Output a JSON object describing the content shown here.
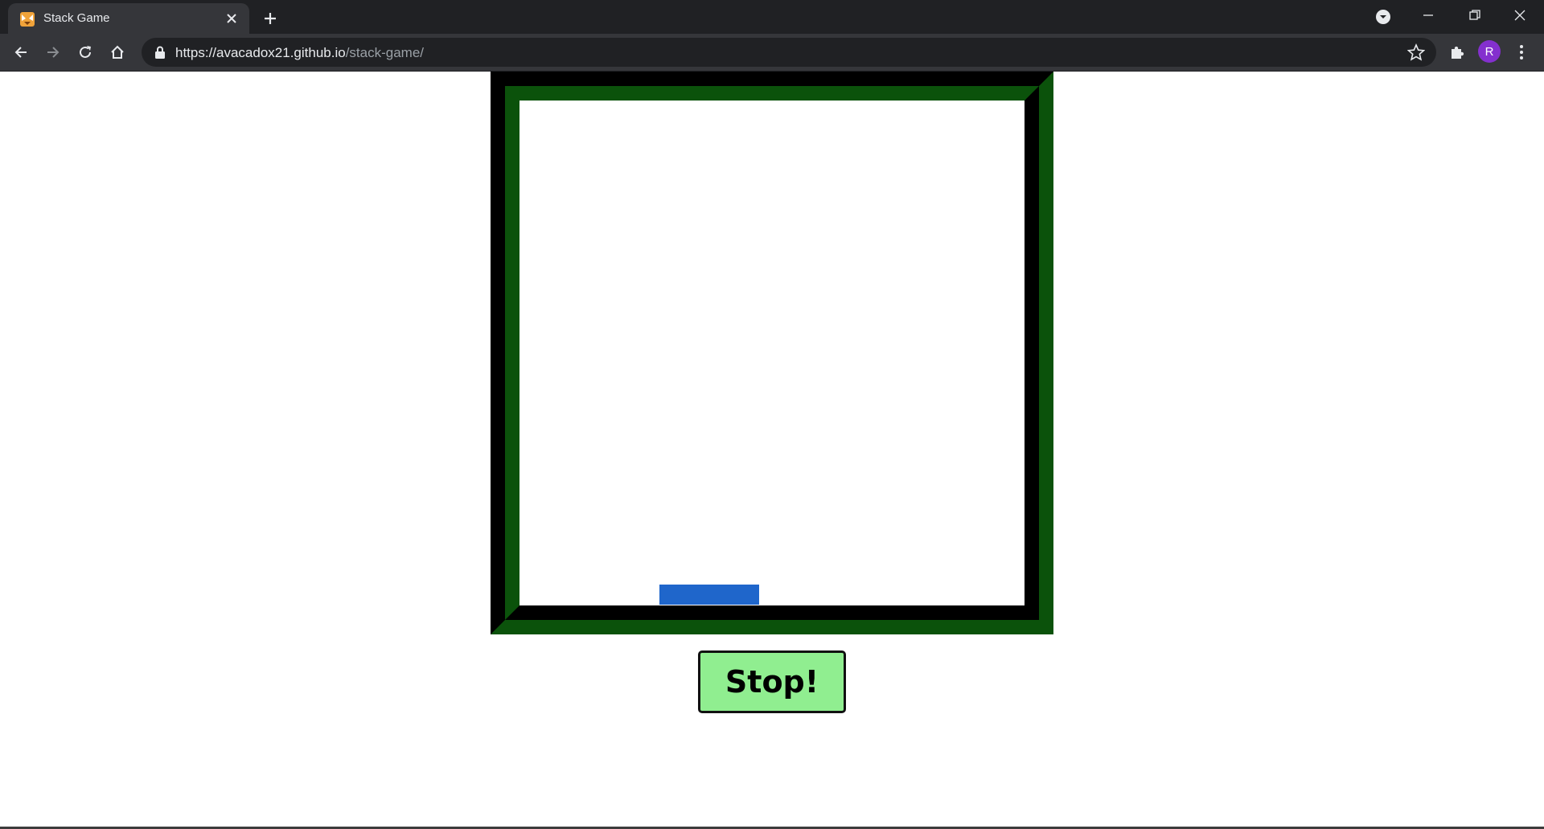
{
  "browser": {
    "tab": {
      "title": "Stack Game",
      "favicon": "fox-favicon-icon",
      "close_icon": "close-icon"
    },
    "new_tab_icon": "plus-icon",
    "url": {
      "host": "https://avacadox21.github.io",
      "path": "/stack-game/"
    },
    "profile_initial": "R",
    "icons": {
      "back": "arrow-left-icon",
      "forward": "arrow-right-icon",
      "reload": "reload-icon",
      "home": "home-icon",
      "lock": "lock-icon",
      "bookmark": "star-icon",
      "extensions": "puzzle-icon",
      "menu": "kebab-menu-icon"
    }
  },
  "game": {
    "stop_label": "Stop!",
    "colors": {
      "border_dark": "#000000",
      "border_green": "#0b520b",
      "block": "#1f66cb",
      "button": "#90ee90"
    }
  }
}
